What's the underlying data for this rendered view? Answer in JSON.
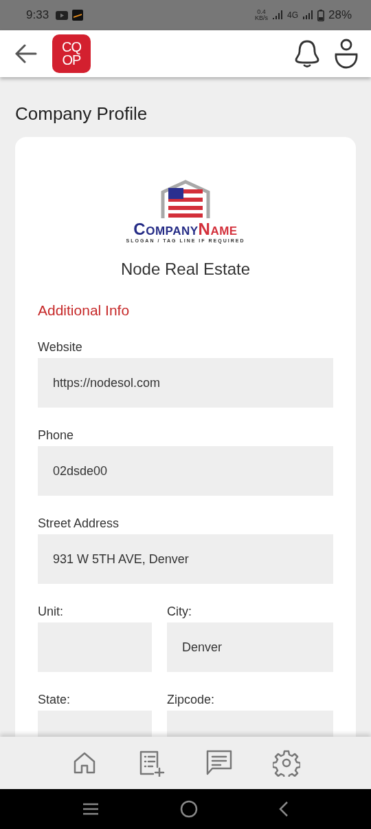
{
  "status_bar": {
    "time": "9:33",
    "speed": [
      "0.4",
      "KB/s"
    ],
    "network": "4G",
    "battery": "28%"
  },
  "header": {
    "logo_lines": [
      "CQ",
      "OP"
    ]
  },
  "page_title": "Company Profile",
  "company": {
    "logo_name": [
      "COMPANY",
      "NAME"
    ],
    "logo_slogan": "SLOGAN / TAG LINE IF REQUIRED",
    "name": "Node Real Estate"
  },
  "section_title": "Additional Info",
  "field_rows": [
    [
      {
        "label": "Website",
        "value": "https://nodesol.com"
      }
    ],
    [
      {
        "label": "Phone",
        "value": "02dsde00"
      }
    ],
    [
      {
        "label": "Street Address",
        "value": "931 W 5TH AVE, Denver"
      }
    ],
    [
      {
        "label": "Unit:"
      },
      {
        "label": "City:",
        "value": "Denver"
      }
    ],
    [
      {
        "label": "State:"
      },
      {
        "label": "Zipcode:"
      }
    ]
  ],
  "bottom_nav": [
    {
      "kind": "home"
    },
    {
      "kind": "add-list"
    },
    {
      "kind": "message"
    },
    {
      "kind": "settings"
    }
  ]
}
